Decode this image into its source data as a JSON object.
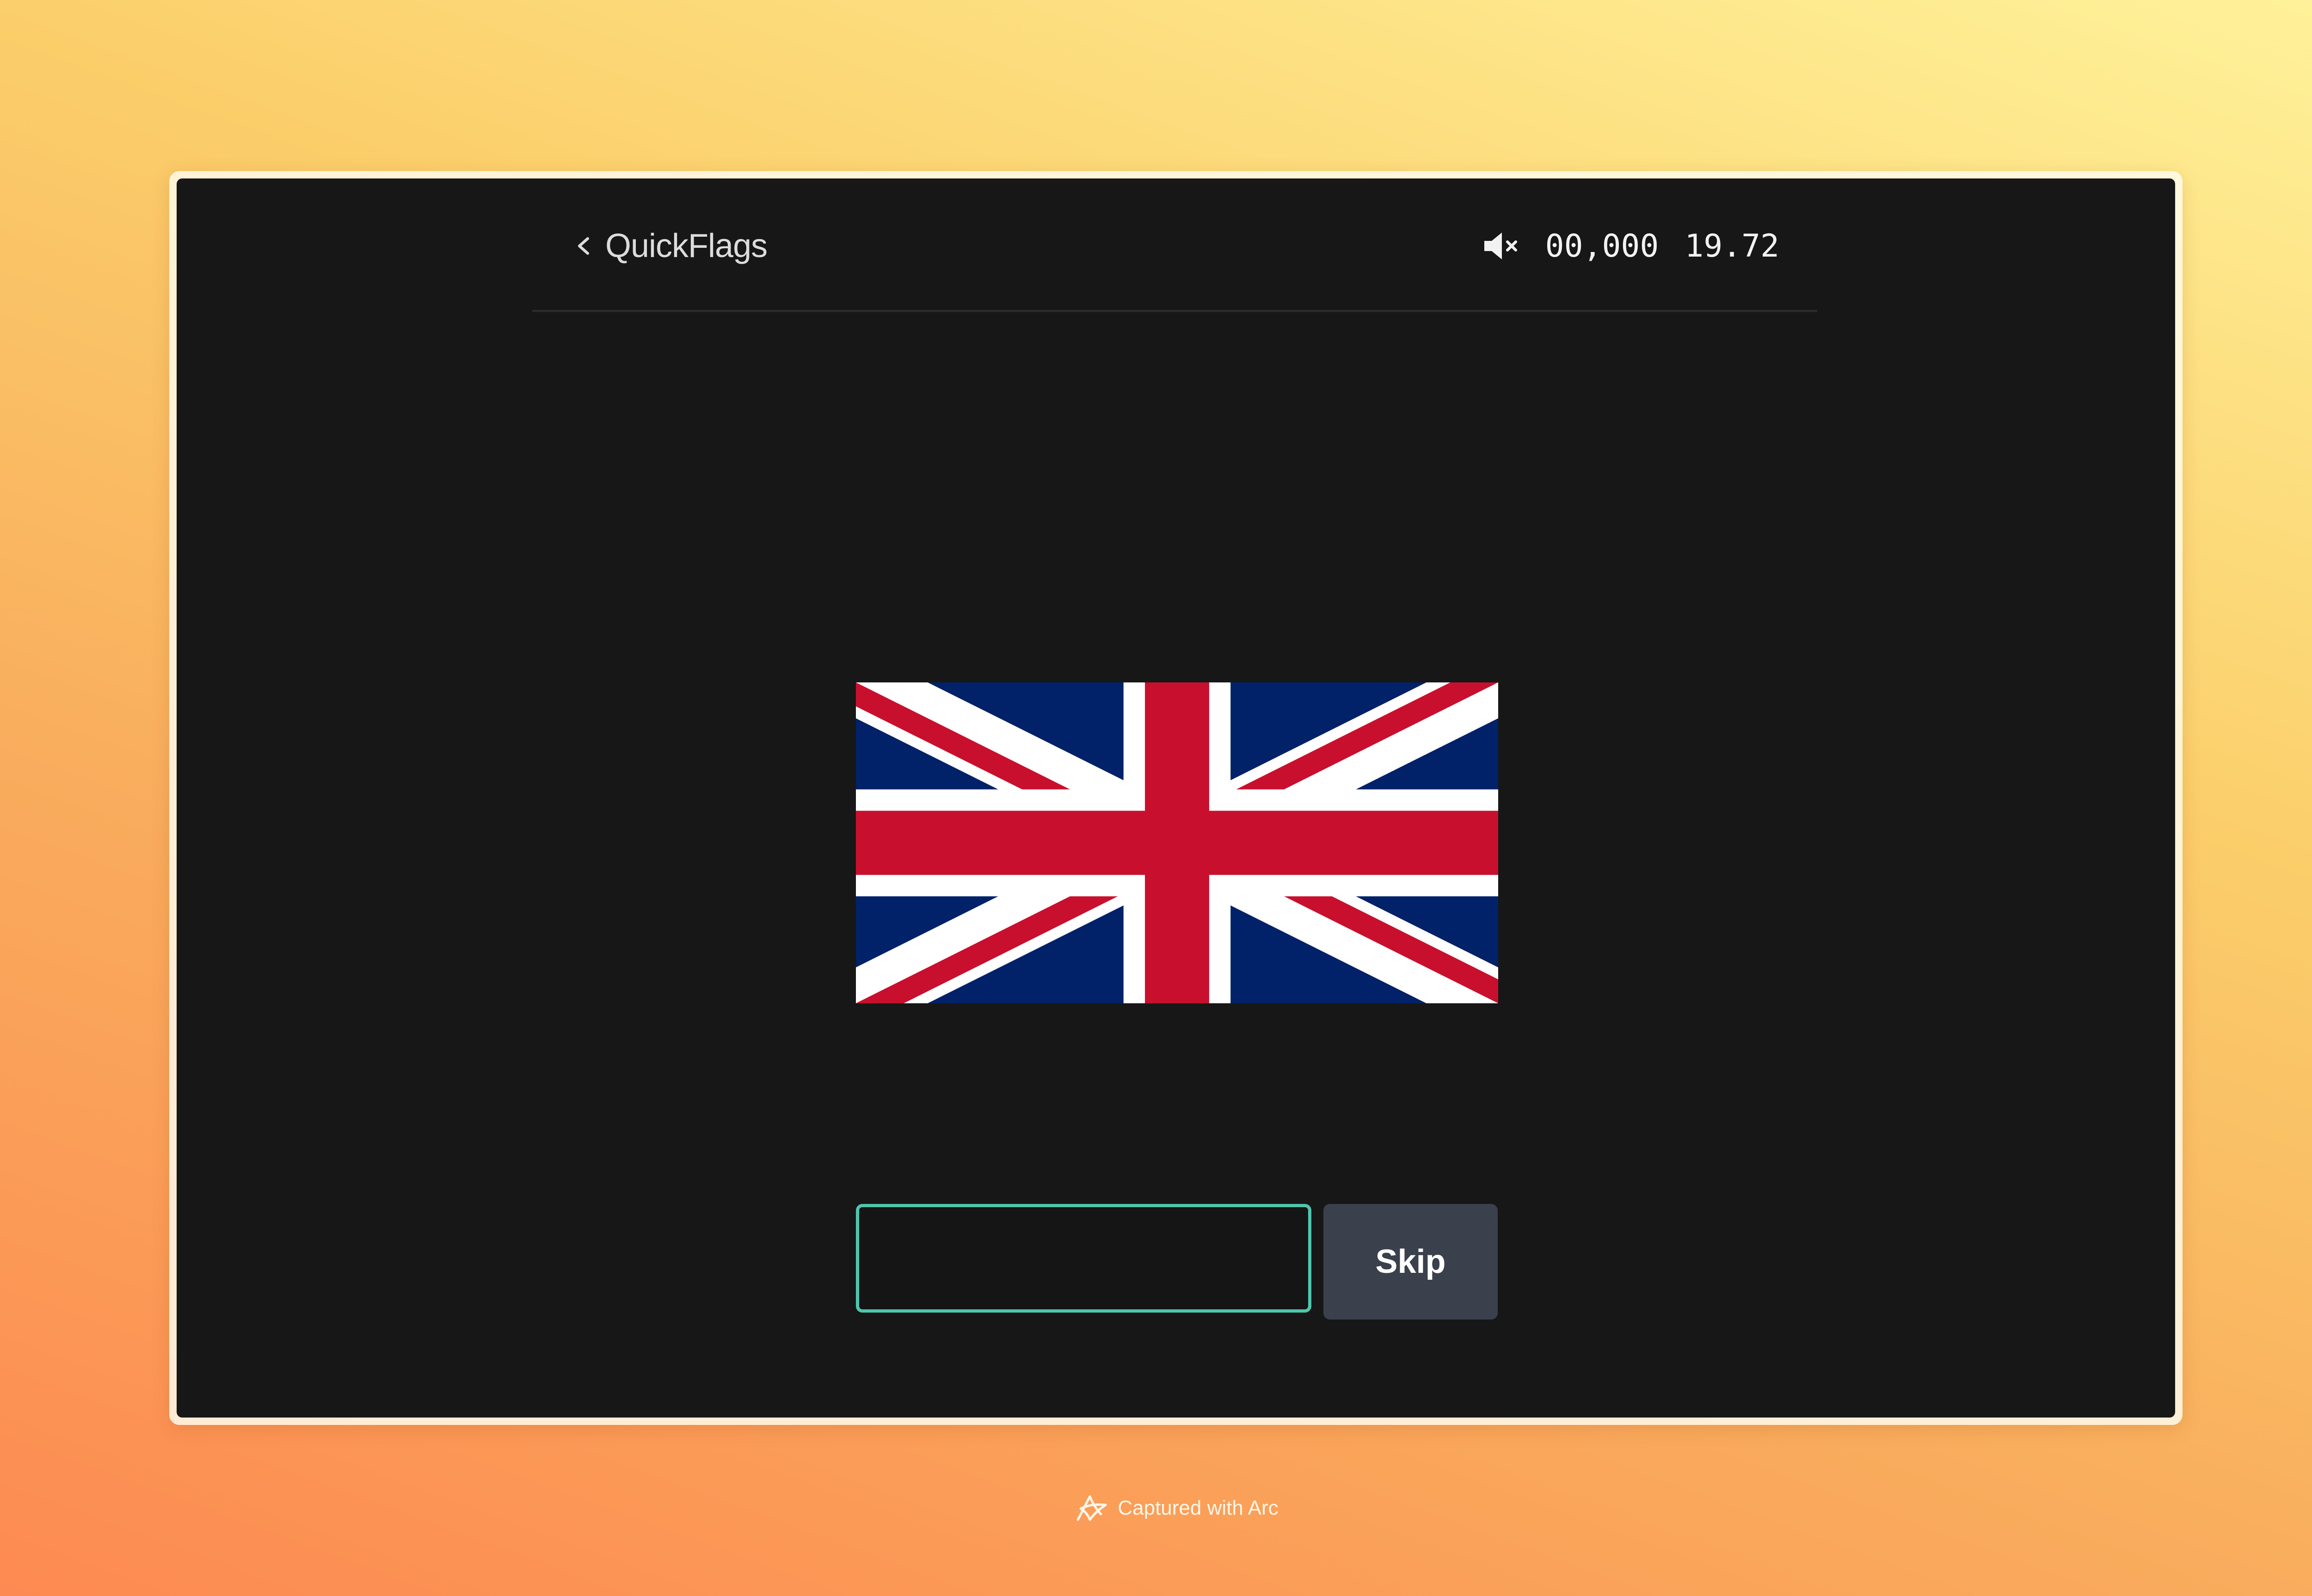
{
  "app": {
    "title": "QuickFlags",
    "back_icon": "chevron-left-icon"
  },
  "status": {
    "sound_icon": "volume-muted-icon",
    "score": "00,000",
    "timer": "19.72"
  },
  "quiz": {
    "flag_icon": "union-jack-flag",
    "answer_value": "",
    "answer_placeholder": "",
    "skip_label": "Skip"
  },
  "footer": {
    "watermark_icon": "arc-logo-icon",
    "watermark_text": "Captured with Arc"
  },
  "colors": {
    "background_top": "#fff29a",
    "background_bottom": "#fd8a52",
    "window": "#171717",
    "input_border": "#4fc6ad",
    "skip_button": "#3a404c",
    "flag_blue": "#012169",
    "flag_red": "#c8102e",
    "flag_white": "#ffffff"
  }
}
